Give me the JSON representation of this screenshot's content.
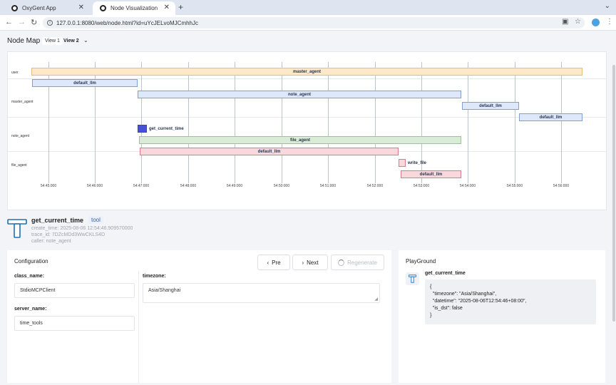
{
  "browser": {
    "tabs": [
      {
        "title": "OxyGent App",
        "active": false
      },
      {
        "title": "Node Visualization",
        "active": true
      }
    ],
    "url": "127.0.0.1:8080/web/node.html?id=uYcJELvoMJCmhhJc"
  },
  "header": {
    "title": "Node Map",
    "views": [
      "View 1",
      "View 2"
    ]
  },
  "node_map": {
    "rows": [
      "user",
      "master_agent",
      "note_agent",
      "file_agent"
    ],
    "ticks": [
      "54:45:000",
      "54:46:000",
      "54:47:000",
      "54:48:000",
      "54:49:000",
      "54:50:000",
      "54:51:000",
      "54:52:000",
      "54:53:000",
      "54:54:000",
      "54:55:000",
      "54:56:000"
    ],
    "nodes": [
      {
        "label": "master_agent"
      },
      {
        "label": "default_llm"
      },
      {
        "label": "note_agent"
      },
      {
        "label": "default_llm"
      },
      {
        "label": "default_llm"
      },
      {
        "label": "get_current_time"
      },
      {
        "label": "file_agent"
      },
      {
        "label": "default_llm"
      },
      {
        "label": "write_file"
      },
      {
        "label": "default_llm"
      }
    ]
  },
  "node_info": {
    "name": "get_current_time",
    "tag": "tool",
    "create_time": "create_time: 2025-08-06 12:54:46.909570000",
    "trace_id": "trace_id: 7DZcMDd3WwCKLS4D",
    "caller": "caller: note_agent"
  },
  "configuration": {
    "title": "Configuration",
    "pre_label": "Pre",
    "next_label": "Next",
    "regen_label": "Regenerate",
    "class_name_label": "class_name:",
    "class_name_value": "StdioMCPClient",
    "server_name_label": "server_name:",
    "server_name_value": "time_tools",
    "timezone_label": "timezone:",
    "timezone_value": "Asia/Shanghai"
  },
  "playground": {
    "title": "PlayGround",
    "tool_name": "get_current_time",
    "output": "{\n  \"timezone\": \"Asia/Shanghai\",\n  \"datetime\": \"2025-08-06T12:54:46+08:00\",\n  \"is_dst\": false\n}"
  },
  "colors": {
    "agent": "#fde8c8",
    "llm": "#dde9fb",
    "file_agent": "#d9ecd7",
    "error": "#f9d8dd",
    "tool": "#4950d8"
  }
}
